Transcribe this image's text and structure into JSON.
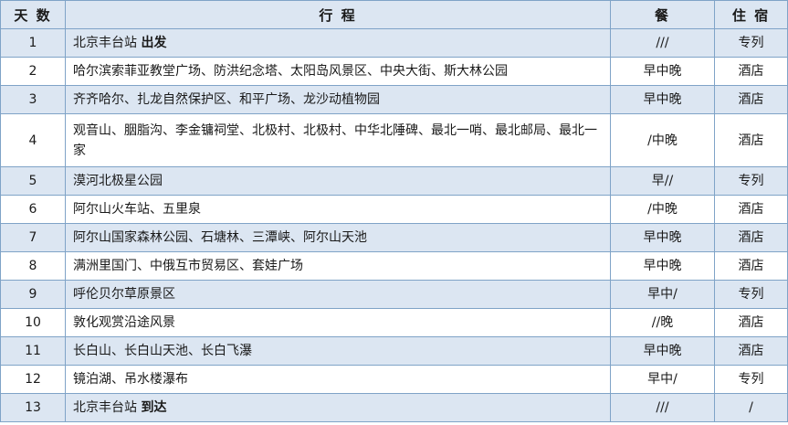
{
  "headers": {
    "day": "天 数",
    "route": "行  程",
    "meal": "餐",
    "stay": "住 宿"
  },
  "rows": [
    {
      "day": "1",
      "route": "北京丰台站 ",
      "route_bold": "出发",
      "meal": "///",
      "stay": "专列"
    },
    {
      "day": "2",
      "route": "哈尔滨索菲亚教堂广场、防洪纪念塔、太阳岛风景区、中央大街、斯大林公园",
      "route_bold": "",
      "meal": "早中晚",
      "stay": "酒店"
    },
    {
      "day": "3",
      "route": "齐齐哈尔、扎龙自然保护区、和平广场、龙沙动植物园",
      "route_bold": "",
      "meal": "早中晚",
      "stay": "酒店"
    },
    {
      "day": "4",
      "route": "观音山、胭脂沟、李金镛祠堂、北极村、北极村、中华北陲碑、最北一哨、最北邮局、最北一家",
      "route_bold": "",
      "meal": "/中晚",
      "stay": "酒店"
    },
    {
      "day": "5",
      "route": "漠河北极星公园",
      "route_bold": "",
      "meal": "早//",
      "stay": "专列"
    },
    {
      "day": "6",
      "route": "阿尔山火车站、五里泉",
      "route_bold": "",
      "meal": "/中晚",
      "stay": "酒店"
    },
    {
      "day": "7",
      "route": "阿尔山国家森林公园、石塘林、三潭峡、阿尔山天池",
      "route_bold": "",
      "meal": "早中晚",
      "stay": "酒店"
    },
    {
      "day": "8",
      "route": "满洲里国门、中俄互市贸易区、套娃广场",
      "route_bold": "",
      "meal": "早中晚",
      "stay": "酒店"
    },
    {
      "day": "9",
      "route": "呼伦贝尔草原景区",
      "route_bold": "",
      "meal": "早中/",
      "stay": "专列"
    },
    {
      "day": "10",
      "route": "敦化观赏沿途风景",
      "route_bold": "",
      "meal": "//晚",
      "stay": "酒店"
    },
    {
      "day": "11",
      "route": "长白山、长白山天池、长白飞瀑",
      "route_bold": "",
      "meal": "早中晚",
      "stay": "酒店"
    },
    {
      "day": "12",
      "route": "镜泊湖、吊水楼瀑布",
      "route_bold": "",
      "meal": "早中/",
      "stay": "专列"
    },
    {
      "day": "13",
      "route": "北京丰台站 ",
      "route_bold": "到达",
      "meal": "///",
      "stay": "/"
    }
  ]
}
